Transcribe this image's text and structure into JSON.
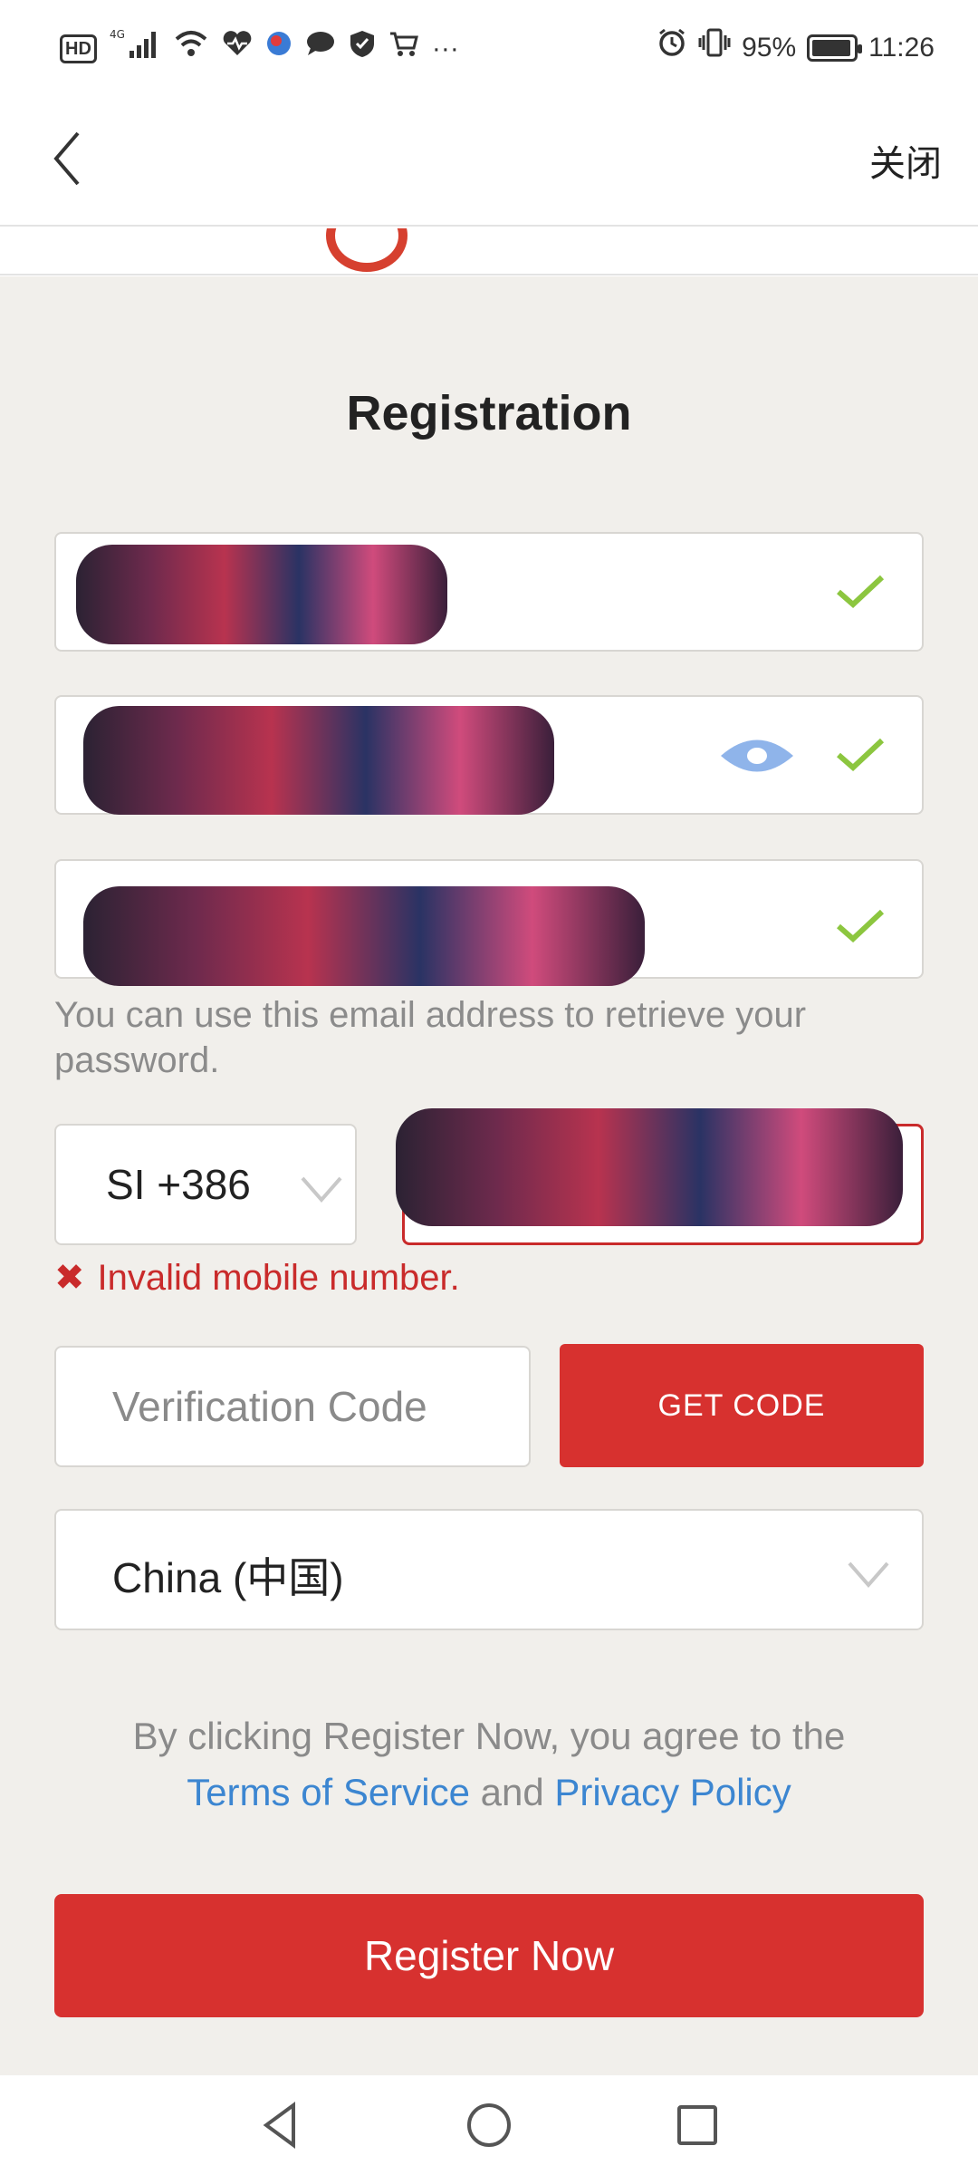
{
  "status_bar": {
    "left_icons": [
      "hd-icon",
      "signal-4g-icon",
      "wifi-icon",
      "health-icon",
      "app-icon",
      "chat-icon",
      "shield-icon",
      "cart-icon",
      "more-icon"
    ],
    "hd_label": "HD",
    "signal_label": "4G",
    "more": "···",
    "battery_percent": "95%",
    "battery_level": 0.95,
    "time": "11:26"
  },
  "header": {
    "close_label": "关闭"
  },
  "form": {
    "title": "Registration",
    "email_hint": "You can use this email address to retrieve your password.",
    "country_code": "SI +386",
    "error_text": "Invalid mobile number.",
    "error_icon": "✖",
    "verification_placeholder": "Verification Code",
    "get_code_label": "GET CODE",
    "region": "China (中国)",
    "agree_prefix": "By clicking Register Now, you agree to the",
    "terms_label": "Terms of Service",
    "and_label": "and",
    "privacy_label": "Privacy Policy",
    "register_label": "Register Now"
  },
  "colors": {
    "accent_red": "#d7312f",
    "check_green": "#8cc63f",
    "link_blue": "#3c86d1",
    "eye_blue": "#8fb4ea",
    "background": "#f1efeb"
  }
}
